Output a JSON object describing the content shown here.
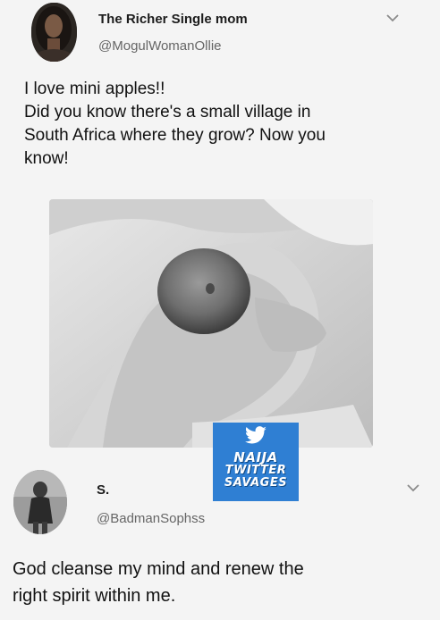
{
  "tweet1": {
    "display_name": "The Richer Single mom",
    "handle": "@MogulWomanOllie",
    "text_lines": [
      "I love mini apples!!",
      "Did you know there's a small village in",
      "South Africa where they grow? Now you",
      "know!"
    ],
    "avatar_icon": "profile-photo"
  },
  "watermark": {
    "icon": "twitter-bird-icon",
    "lines": [
      "NAIJA",
      "TWITTER",
      "SAVAGES"
    ],
    "color": "#2f7fd3"
  },
  "tweet2": {
    "display_name": "S.",
    "handle": "@BadmanSophss",
    "text_lines": [
      "God cleanse my mind and renew the",
      "right spirit within me."
    ],
    "avatar_icon": "profile-photo"
  }
}
